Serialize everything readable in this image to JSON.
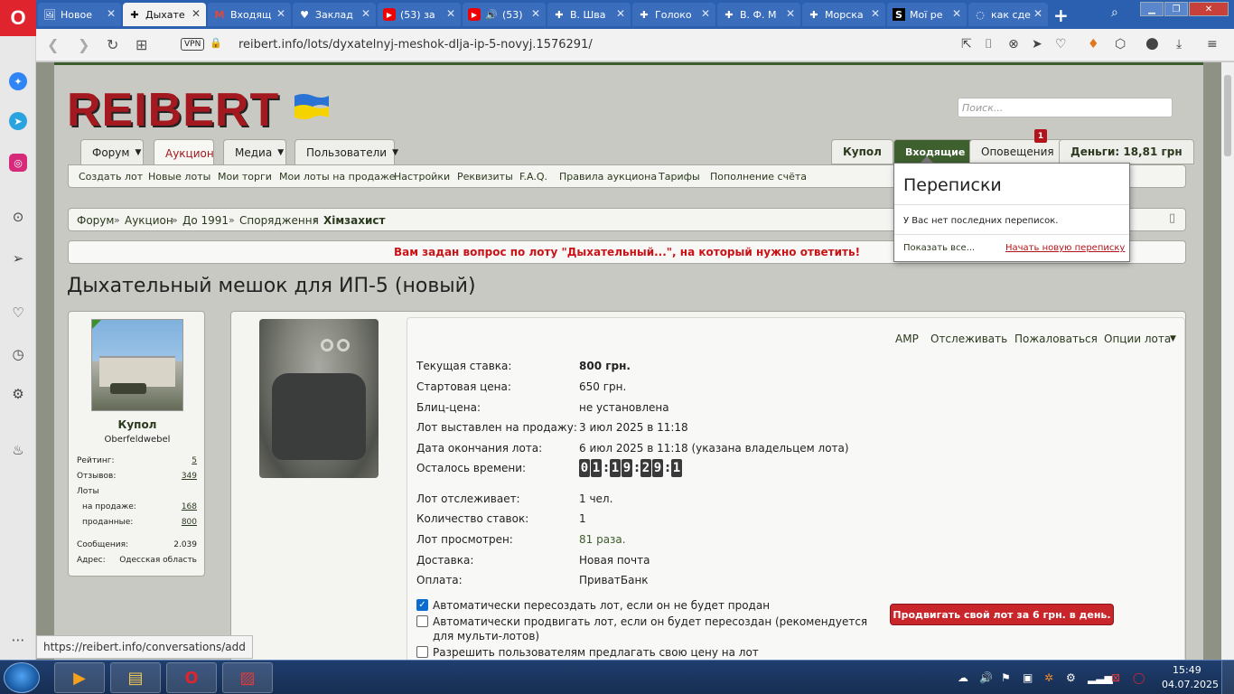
{
  "browser": {
    "tabs": [
      {
        "label": "Новое",
        "icon": "🖼"
      },
      {
        "label": "Дыхате",
        "icon": "✚"
      },
      {
        "label": "Входящ",
        "icon": "M"
      },
      {
        "label": "Заклад",
        "icon": "♥"
      },
      {
        "label": "(53) за",
        "icon": "▶"
      },
      {
        "label": "(53)",
        "icon": "▶"
      },
      {
        "label": "В. Шва",
        "icon": "✚"
      },
      {
        "label": "Голоко",
        "icon": "✚"
      },
      {
        "label": "В. Ф. М",
        "icon": "✚"
      },
      {
        "label": "Морска",
        "icon": "✚"
      },
      {
        "label": "Мої ре",
        "icon": "S"
      },
      {
        "label": "как сде",
        "icon": "◌"
      }
    ],
    "vpn_label": "VPN",
    "url": "reibert.info/lots/dyxatelnyj-meshok-dlja-ip-5-novyj.1576291/",
    "status_url": "https://reibert.info/conversations/add"
  },
  "site": {
    "logo_text": "REIBERT",
    "search_placeholder": "Поиск...",
    "nav_tabs": [
      {
        "label": "Форум",
        "dropdown": true
      },
      {
        "label": "Аукцион",
        "dropdown": false
      },
      {
        "label": "Медиа",
        "dropdown": true
      },
      {
        "label": "Пользователи",
        "dropdown": true
      }
    ],
    "user_tabs": {
      "username": "Купол",
      "inbox": "Входящие",
      "alerts": "Оповещения",
      "alerts_count": "1",
      "money": "Деньги: 18,81 грн"
    },
    "sub_nav": [
      "Создать лот",
      "Новые лоты",
      "Мои торги",
      "Мои лоты на продаже",
      "Настройки",
      "Реквизиты",
      "F.A.Q.",
      "Правила аукциона",
      "Тарифы",
      "Пополнение счёта"
    ],
    "breadcrumbs": [
      "Форум",
      "Аукцион",
      "До 1991",
      "Спорядження",
      "Хімзахист"
    ],
    "notice": "Вам задан вопрос по лоту \"Дыхательный...\", на который нужно ответить!"
  },
  "conversations": {
    "title": "Переписки",
    "empty_text": "У Вас нет последних переписок.",
    "show_all": "Показать все...",
    "start_new": "Начать новую переписку"
  },
  "lot": {
    "title": "Дыхательный мешок для ИП-5 (новый)",
    "actions": [
      "AMP",
      "Отслеживать",
      "Пожаловаться",
      "Опции лота"
    ],
    "details": [
      {
        "label": "Текущая ставка:",
        "value": "800 грн."
      },
      {
        "label": "Стартовая цена:",
        "value": "650 грн."
      },
      {
        "label": "Блиц-цена:",
        "value": "не установлена"
      },
      {
        "label": "Лот выставлен на продажу:",
        "value": "3 июл 2025 в 11:18"
      },
      {
        "label": "Дата окончания лота:",
        "value": "6 июл 2025 в 11:18 (указана владельцем лота)"
      },
      {
        "label": "Осталось времени:",
        "value": ""
      },
      {
        "label": "Лот отслеживает:",
        "value": "1 чел."
      },
      {
        "label": "Количество ставок:",
        "value": "1"
      },
      {
        "label": "Лот просмотрен:",
        "value": "81 раза."
      },
      {
        "label": "Доставка:",
        "value": "Новая почта"
      },
      {
        "label": "Оплата:",
        "value": "ПриватБанк"
      }
    ],
    "timer_digits": [
      "0",
      "1",
      "1",
      "9",
      "2",
      "9",
      "1"
    ],
    "options": [
      {
        "label": "Автоматически пересоздать лот, если он не будет продан",
        "checked": true
      },
      {
        "label": "Автоматически продвигать лот, если он будет пересоздан (рекомендуется для мульти-лотов)",
        "checked": false
      },
      {
        "label": "Разрешить пользователям предлагать свою цену на лот",
        "checked": false
      }
    ],
    "promote_button": "Продвигать свой лот за 6 грн. в день."
  },
  "seller": {
    "name": "Купол",
    "rank": "Oberfeldwebel",
    "stats": [
      {
        "label": "Рейтинг:",
        "value": "5",
        "link": true
      },
      {
        "label": "Отзывов:",
        "value": "349",
        "link": true
      },
      {
        "label": "Лоты",
        "value": "",
        "link": false
      },
      {
        "label": "на продаже:",
        "value": "168",
        "link": true
      },
      {
        "label": "проданные:",
        "value": "800",
        "link": true
      },
      {
        "label": "Сообщения:",
        "value": "2.039",
        "link": false
      },
      {
        "label": "Адрес:",
        "value": "Одесская область",
        "link": false
      }
    ]
  },
  "taskbar": {
    "time": "15:49",
    "date": "04.07.2025"
  }
}
